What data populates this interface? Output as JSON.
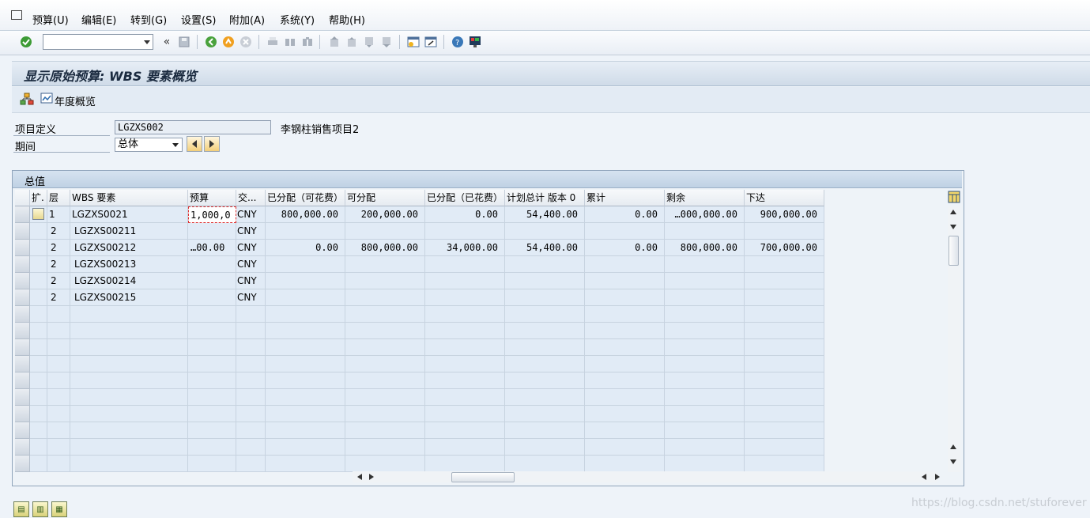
{
  "menu": {
    "items": [
      "预算(U)",
      "编辑(E)",
      "转到(G)",
      "设置(S)",
      "附加(A)",
      "系统(Y)",
      "帮助(H)"
    ]
  },
  "toolbar": {
    "command_field": "",
    "icons": [
      "enter-icon",
      "back-double-icon",
      "save-icon",
      "back-icon",
      "exit-icon",
      "cancel-icon",
      "print-icon",
      "find-icon",
      "find-next-icon",
      "first-page-icon",
      "prev-page-icon",
      "next-page-icon",
      "last-page-icon",
      "create-session-icon",
      "shortcut-icon",
      "help-icon",
      "customize-layout-icon"
    ]
  },
  "title": "显示原始预算: WBS 要素概览",
  "app_toolbar": {
    "hierarchy_icon": "hierarchy-icon",
    "annual_overview_label": "年度概览"
  },
  "form": {
    "project_def_label": "项目定义",
    "project_def_value": "LGZXS002",
    "project_desc": "李钢柱销售项目2",
    "period_label": "期间",
    "period_value": "总体"
  },
  "table": {
    "title": "总值",
    "headers": [
      "扩.",
      "层",
      "WBS 要素",
      "预算",
      "交...",
      "已分配（可花费）",
      "可分配",
      "已分配（已花费）",
      "计划总计 版本 0",
      "累计",
      "剩余",
      "下达"
    ],
    "rows": [
      {
        "level": "1",
        "wbs": "LGZXS0021",
        "budget": "1,000,0",
        "currency": "CNY",
        "alloc_spendable": "800,000.00",
        "distributable": "200,000.00",
        "alloc_spent": "0.00",
        "plan_total": "54,400.00",
        "cumulative": "0.00",
        "remaining": "…000,000.00",
        "released": "900,000.00"
      },
      {
        "level": "2",
        "wbs": "LGZXS00211",
        "budget": "",
        "currency": "CNY",
        "alloc_spendable": "",
        "distributable": "",
        "alloc_spent": "",
        "plan_total": "",
        "cumulative": "",
        "remaining": "",
        "released": ""
      },
      {
        "level": "2",
        "wbs": "LGZXS00212",
        "budget": "…00.00",
        "currency": "CNY",
        "alloc_spendable": "0.00",
        "distributable": "800,000.00",
        "alloc_spent": "34,000.00",
        "plan_total": "54,400.00",
        "cumulative": "0.00",
        "remaining": "800,000.00",
        "released": "700,000.00"
      },
      {
        "level": "2",
        "wbs": "LGZXS00213",
        "budget": "",
        "currency": "CNY",
        "alloc_spendable": "",
        "distributable": "",
        "alloc_spent": "",
        "plan_total": "",
        "cumulative": "",
        "remaining": "",
        "released": ""
      },
      {
        "level": "2",
        "wbs": "LGZXS00214",
        "budget": "",
        "currency": "CNY",
        "alloc_spendable": "",
        "distributable": "",
        "alloc_spent": "",
        "plan_total": "",
        "cumulative": "",
        "remaining": "",
        "released": ""
      },
      {
        "level": "2",
        "wbs": "LGZXS00215",
        "budget": "",
        "currency": "CNY",
        "alloc_spendable": "",
        "distributable": "",
        "alloc_spent": "",
        "plan_total": "",
        "cumulative": "",
        "remaining": "",
        "released": ""
      }
    ]
  },
  "bottom_buttons": [
    "select-all-icon",
    "deselect-all-icon",
    "select-block-icon"
  ],
  "watermark": "https://blog.csdn.net/stuforever"
}
